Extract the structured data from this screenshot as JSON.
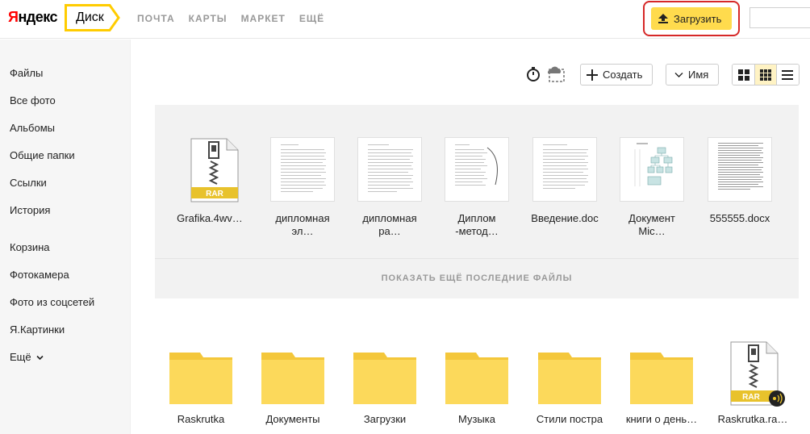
{
  "header": {
    "logo_first": "Я",
    "logo_rest": "ндекс",
    "disk_tab": "Диск",
    "nav": [
      "ПОЧТА",
      "КАРТЫ",
      "МАРКЕТ",
      "ЕЩЁ"
    ],
    "upload_label": "Загрузить"
  },
  "sidebar": {
    "items": [
      "Файлы",
      "Все фото",
      "Альбомы",
      "Общие папки",
      "Ссылки",
      "История",
      "Корзина",
      "Фотокамера",
      "Фото из соцсетей",
      "Я.Картинки",
      "Ещё"
    ]
  },
  "toolbar": {
    "create_label": "Создать",
    "sort_label": "Имя"
  },
  "recent": {
    "files": [
      {
        "line1": "Grafika.4wv…",
        "line2": "",
        "type": "rar"
      },
      {
        "line1": "дипломная",
        "line2": "эл…",
        "type": "doc"
      },
      {
        "line1": "дипломная",
        "line2": "ра…",
        "type": "doc"
      },
      {
        "line1": "Диплом",
        "line2": "-метод…",
        "type": "doc"
      },
      {
        "line1": "Введение.doc",
        "line2": "",
        "type": "doc"
      },
      {
        "line1": "Документ",
        "line2": "Mic…",
        "type": "diagram"
      },
      {
        "line1": "555555.docx",
        "line2": "",
        "type": "doc"
      }
    ],
    "show_more": "ПОКАЗАТЬ ЕЩЁ ПОСЛЕДНИЕ ФАЙЛЫ",
    "rar_badge": "RAR"
  },
  "folders": [
    {
      "name": "Raskrutka",
      "type": "folder"
    },
    {
      "name": "Документы",
      "type": "folder"
    },
    {
      "name": "Загрузки",
      "type": "folder"
    },
    {
      "name": "Музыка",
      "type": "folder"
    },
    {
      "name": "Стили постра",
      "type": "folder"
    },
    {
      "name": "книги о день…",
      "type": "folder"
    },
    {
      "name": "Raskrutka.ra…",
      "type": "rar"
    }
  ],
  "colors": {
    "accent": "#ffdb4d",
    "folder": "#fcd95b",
    "folder_tab": "#f4c73b",
    "highlight": "#d62828",
    "rar_badge": "#e8c22c"
  }
}
